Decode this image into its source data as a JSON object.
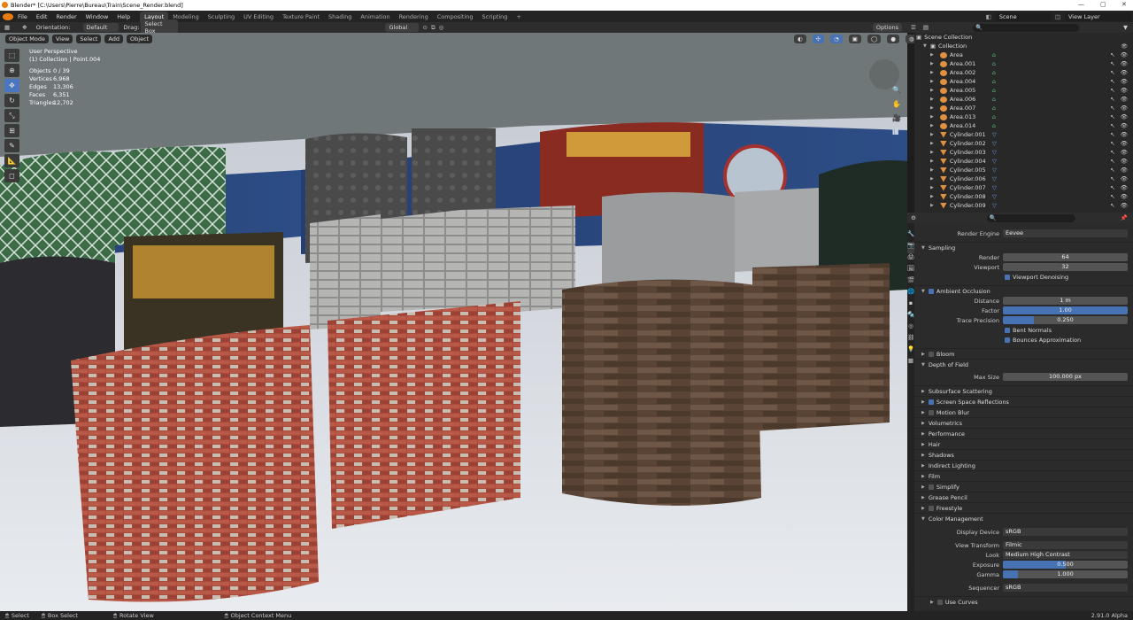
{
  "window": {
    "title": "Blender* [C:\\Users\\Pierre\\Bureau\\Train\\Scene_Render.blend]"
  },
  "menu": [
    "File",
    "Edit",
    "Render",
    "Window",
    "Help"
  ],
  "workspaces": [
    "Layout",
    "Modeling",
    "Sculpting",
    "UV Editing",
    "Texture Paint",
    "Shading",
    "Animation",
    "Rendering",
    "Compositing",
    "Scripting"
  ],
  "scene": {
    "name": "Scene",
    "view_layer": "View Layer"
  },
  "header": {
    "orientation_label": "Orientation:",
    "orientation": "Default",
    "drag_label": "Drag:",
    "drag": "Select Box",
    "transform": "Global",
    "options": "Options"
  },
  "viewport_header": {
    "mode": "Object Mode",
    "menus": [
      "View",
      "Select",
      "Add",
      "Object"
    ]
  },
  "viewport_info": {
    "perspective": "User Perspective",
    "collection": "(1) Collection | Point.004",
    "stats": [
      {
        "k": "Objects",
        "v": "0 / 39"
      },
      {
        "k": "Vertices",
        "v": "6,968"
      },
      {
        "k": "Edges",
        "v": "13,306"
      },
      {
        "k": "Faces",
        "v": "6,351"
      },
      {
        "k": "Triangles",
        "v": "12,702"
      }
    ]
  },
  "outliner": {
    "root": "Scene Collection",
    "collection": "Collection",
    "items": [
      {
        "name": "Area",
        "type": "light"
      },
      {
        "name": "Area.001",
        "type": "light"
      },
      {
        "name": "Area.002",
        "type": "light"
      },
      {
        "name": "Area.004",
        "type": "light"
      },
      {
        "name": "Area.005",
        "type": "light"
      },
      {
        "name": "Area.006",
        "type": "light"
      },
      {
        "name": "Area.007",
        "type": "light"
      },
      {
        "name": "Area.013",
        "type": "light"
      },
      {
        "name": "Area.014",
        "type": "light"
      },
      {
        "name": "Cylinder.001",
        "type": "mesh"
      },
      {
        "name": "Cylinder.002",
        "type": "mesh"
      },
      {
        "name": "Cylinder.003",
        "type": "mesh"
      },
      {
        "name": "Cylinder.004",
        "type": "mesh"
      },
      {
        "name": "Cylinder.005",
        "type": "mesh"
      },
      {
        "name": "Cylinder.006",
        "type": "mesh"
      },
      {
        "name": "Cylinder.007",
        "type": "mesh"
      },
      {
        "name": "Cylinder.008",
        "type": "mesh"
      },
      {
        "name": "Cylinder.009",
        "type": "mesh"
      }
    ]
  },
  "properties": {
    "render_engine_label": "Render Engine",
    "render_engine": "Eevee",
    "sampling": {
      "title": "Sampling",
      "render_label": "Render",
      "render": "64",
      "viewport_label": "Viewport",
      "viewport": "32",
      "denoise": "Viewport Denoising"
    },
    "ao": {
      "title": "Ambient Occlusion",
      "distance_label": "Distance",
      "distance": "1 m",
      "factor_label": "Factor",
      "factor": "1.00",
      "factor_fill": 1.0,
      "trace_label": "Trace Precision",
      "trace": "0.250",
      "trace_fill": 0.25,
      "bent": "Bent Normals",
      "bounces": "Bounces Approximation"
    },
    "bloom": "Bloom",
    "dof": {
      "title": "Depth of Field",
      "max_size_label": "Max Size",
      "max_size": "100.000 px"
    },
    "sss": "Subsurface Scattering",
    "ssr": "Screen Space Reflections",
    "motion_blur": "Motion Blur",
    "volumetrics": "Volumetrics",
    "performance": "Performance",
    "hair": "Hair",
    "shadows": "Shadows",
    "indirect": "Indirect Lighting",
    "film": "Film",
    "simplify": "Simplify",
    "grease_pencil": "Grease Pencil",
    "freestyle": "Freestyle",
    "cm": {
      "title": "Color Management",
      "display_label": "Display Device",
      "display": "sRGB",
      "transform_label": "View Transform",
      "transform": "Filmic",
      "look_label": "Look",
      "look": "Medium High Contrast",
      "exposure_label": "Exposure",
      "exposure": "0.500",
      "exposure_fill": 0.5,
      "gamma_label": "Gamma",
      "gamma": "1.000",
      "gamma_fill": 0.12,
      "sequencer_label": "Sequencer",
      "sequencer": "sRGB",
      "curves": "Use Curves"
    }
  },
  "status": {
    "select": "Select",
    "box": "Box Select",
    "rotate": "Rotate View",
    "context": "Object Context Menu",
    "version": "2.91.0 Alpha"
  }
}
